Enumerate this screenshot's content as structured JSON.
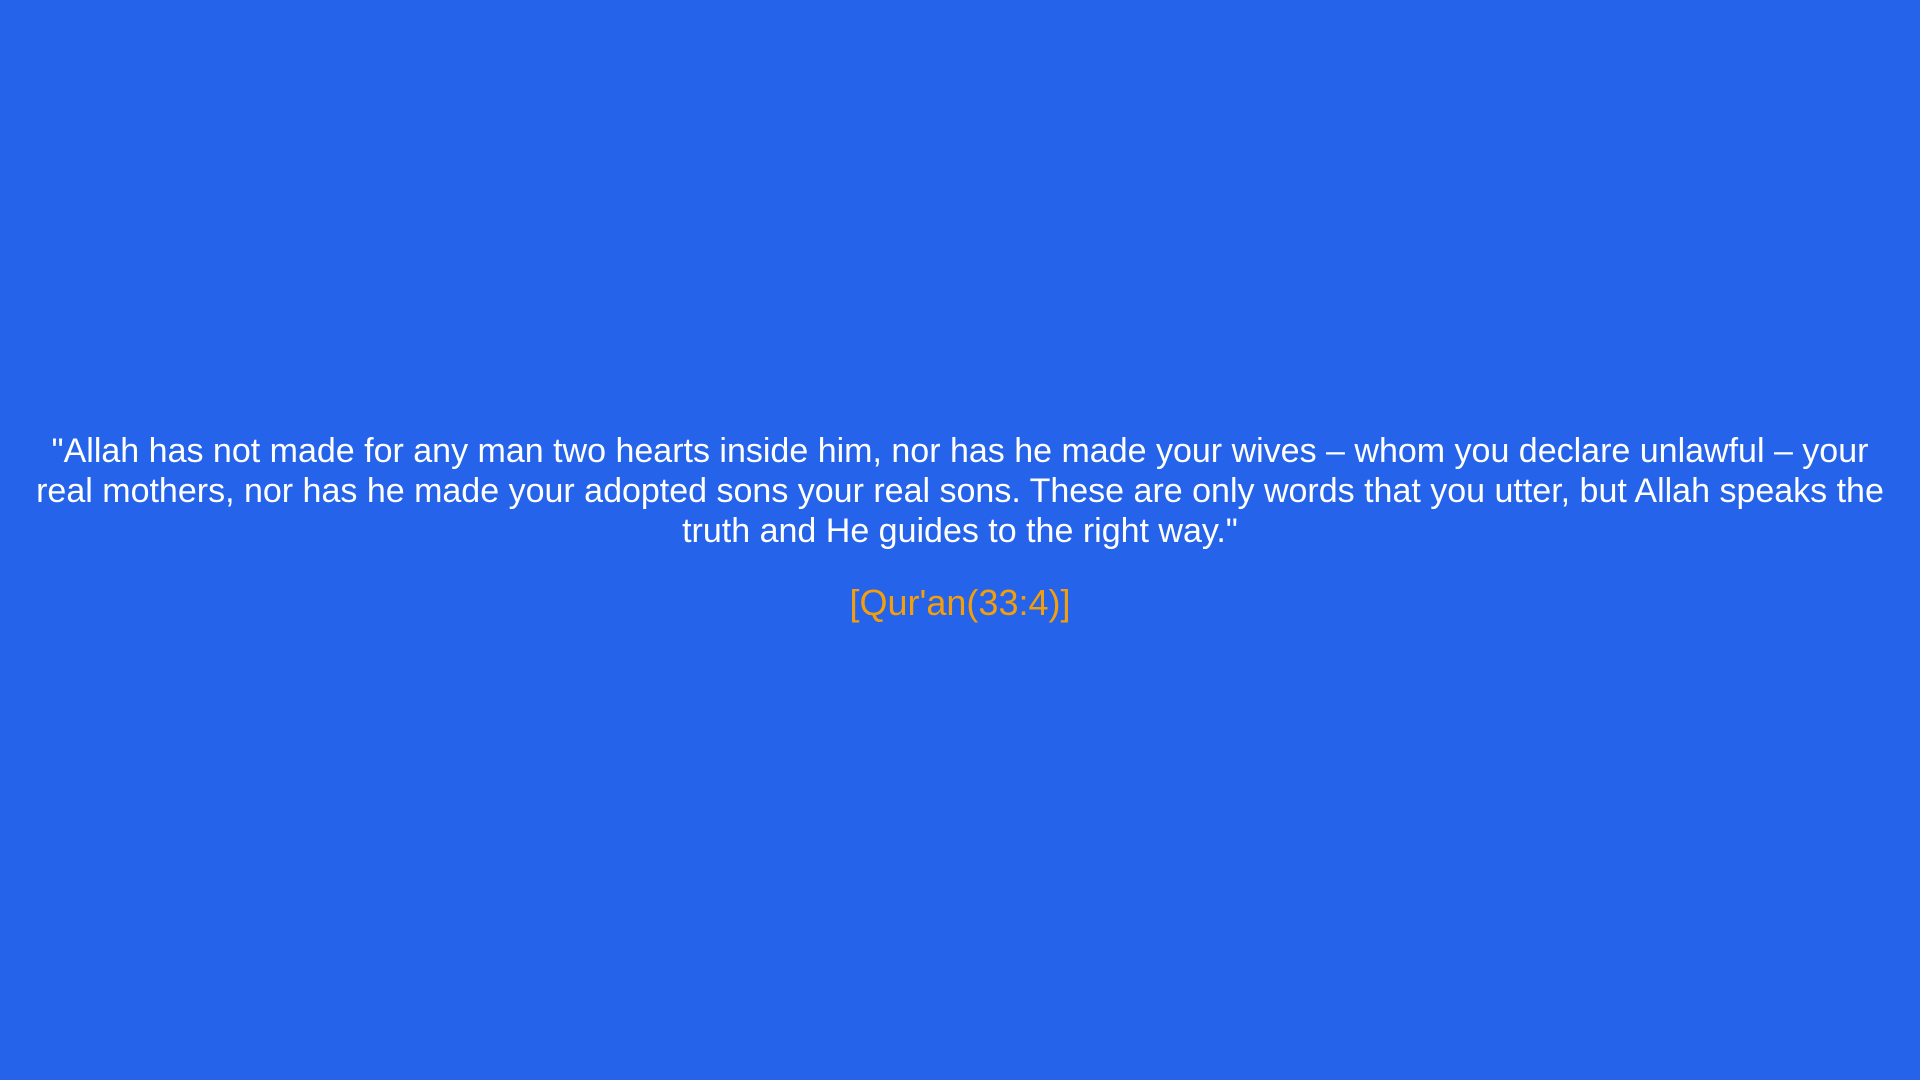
{
  "quote": {
    "text": "\"Allah has not made for any man two hearts inside him, nor has he made your wives – whom you declare unlawful – your real mothers, nor has he made your adopted sons your real sons. These are only words that you utter, but Allah speaks the truth and He guides to the right way.\"",
    "reference": "[Qur'an(33:4)]"
  },
  "colors": {
    "background": "#2563eb",
    "quote_text": "#ffffff",
    "reference_text": "#f59e0b"
  }
}
